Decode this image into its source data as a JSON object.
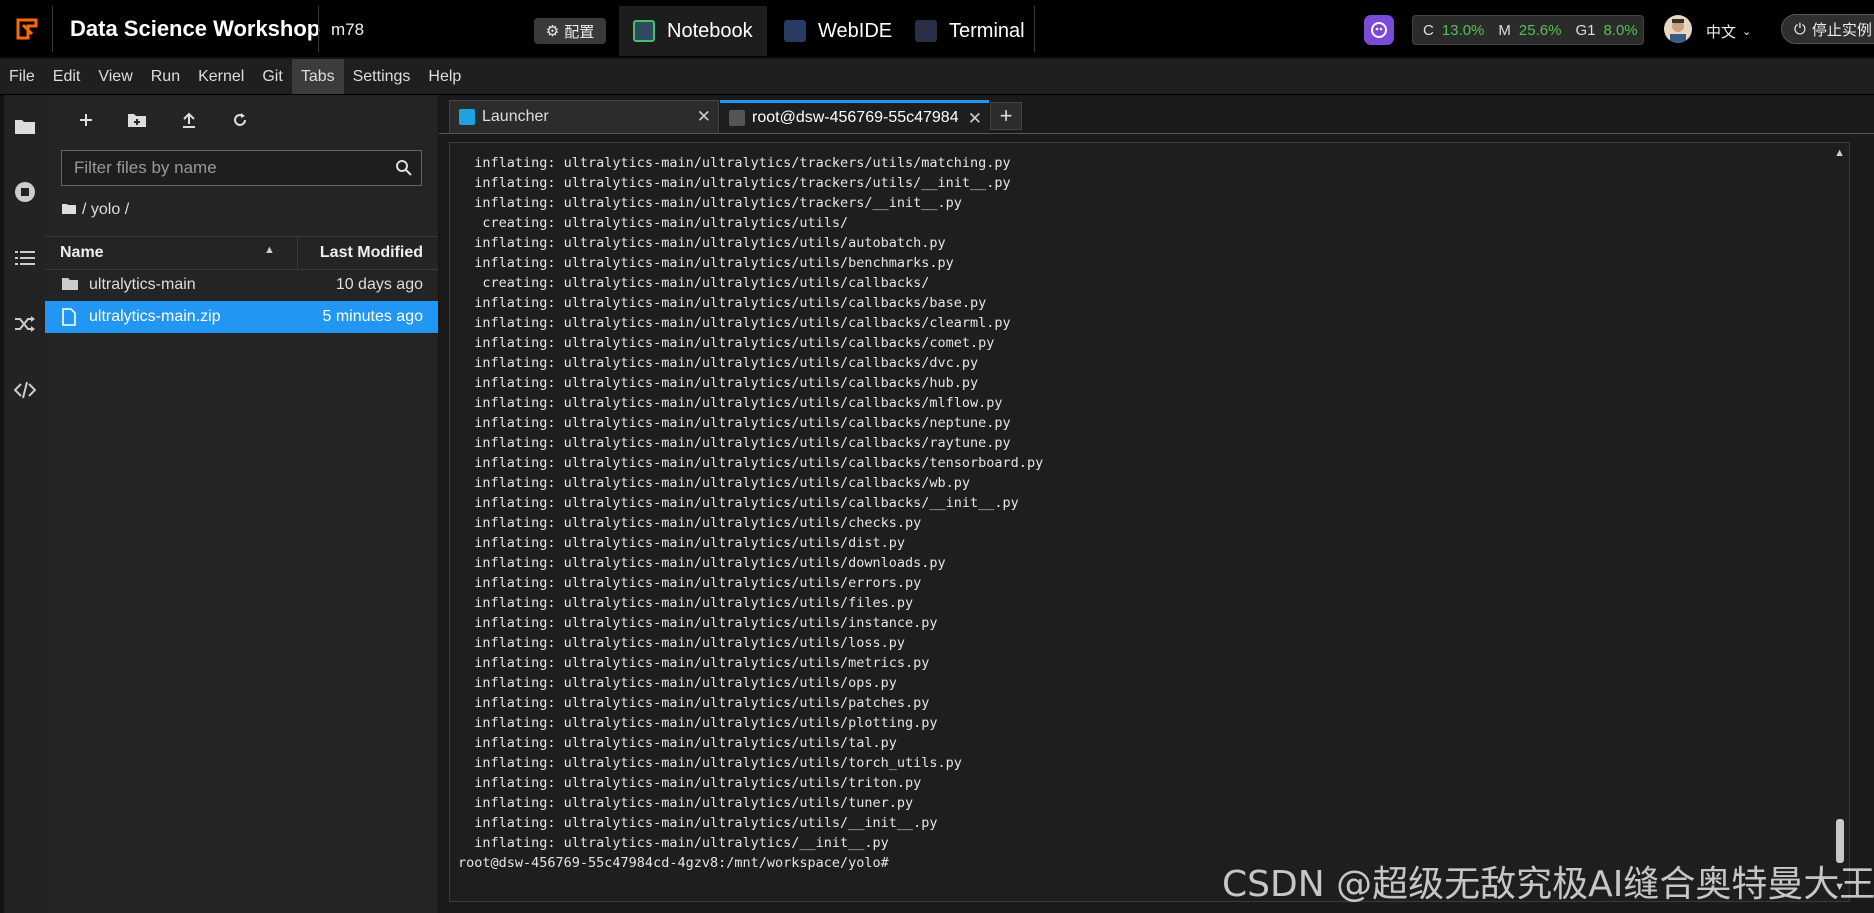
{
  "topbar": {
    "app_title": "Data Science Workshop",
    "instance_name": "m78",
    "config_label": "配置",
    "modes": [
      {
        "label": "Notebook",
        "active": true
      },
      {
        "label": "WebIDE",
        "active": false
      },
      {
        "label": "Terminal",
        "active": false
      }
    ],
    "resources": {
      "cpu_label": "C",
      "cpu_value": "13.0%",
      "mem_label": "M",
      "mem_value": "25.6%",
      "gpu_label": "G1",
      "gpu_value": "8.0%"
    },
    "language": "中文",
    "stop_label": "停止实例"
  },
  "menubar": {
    "items": [
      "File",
      "Edit",
      "View",
      "Run",
      "Kernel",
      "Git",
      "Tabs",
      "Settings",
      "Help"
    ],
    "active": "Tabs"
  },
  "filebrowser": {
    "filter_placeholder": "Filter files by name",
    "breadcrumb": "/ yolo /",
    "col_name": "Name",
    "col_modified": "Last Modified",
    "files": [
      {
        "name": "ultralytics-main",
        "type": "folder",
        "modified": "10 days ago",
        "selected": false
      },
      {
        "name": "ultralytics-main.zip",
        "type": "file",
        "modified": "5 minutes ago",
        "selected": true
      }
    ]
  },
  "tabs": {
    "launcher_label": "Launcher",
    "terminal_label": "root@dsw-456769-55c47984",
    "add_label": "+"
  },
  "terminal": {
    "lines": [
      "  inflating: ultralytics-main/ultralytics/trackers/utils/matching.py",
      "  inflating: ultralytics-main/ultralytics/trackers/utils/__init__.py",
      "  inflating: ultralytics-main/ultralytics/trackers/__init__.py",
      "   creating: ultralytics-main/ultralytics/utils/",
      "  inflating: ultralytics-main/ultralytics/utils/autobatch.py",
      "  inflating: ultralytics-main/ultralytics/utils/benchmarks.py",
      "   creating: ultralytics-main/ultralytics/utils/callbacks/",
      "  inflating: ultralytics-main/ultralytics/utils/callbacks/base.py",
      "  inflating: ultralytics-main/ultralytics/utils/callbacks/clearml.py",
      "  inflating: ultralytics-main/ultralytics/utils/callbacks/comet.py",
      "  inflating: ultralytics-main/ultralytics/utils/callbacks/dvc.py",
      "  inflating: ultralytics-main/ultralytics/utils/callbacks/hub.py",
      "  inflating: ultralytics-main/ultralytics/utils/callbacks/mlflow.py",
      "  inflating: ultralytics-main/ultralytics/utils/callbacks/neptune.py",
      "  inflating: ultralytics-main/ultralytics/utils/callbacks/raytune.py",
      "  inflating: ultralytics-main/ultralytics/utils/callbacks/tensorboard.py",
      "  inflating: ultralytics-main/ultralytics/utils/callbacks/wb.py",
      "  inflating: ultralytics-main/ultralytics/utils/callbacks/__init__.py",
      "  inflating: ultralytics-main/ultralytics/utils/checks.py",
      "  inflating: ultralytics-main/ultralytics/utils/dist.py",
      "  inflating: ultralytics-main/ultralytics/utils/downloads.py",
      "  inflating: ultralytics-main/ultralytics/utils/errors.py",
      "  inflating: ultralytics-main/ultralytics/utils/files.py",
      "  inflating: ultralytics-main/ultralytics/utils/instance.py",
      "  inflating: ultralytics-main/ultralytics/utils/loss.py",
      "  inflating: ultralytics-main/ultralytics/utils/metrics.py",
      "  inflating: ultralytics-main/ultralytics/utils/ops.py",
      "  inflating: ultralytics-main/ultralytics/utils/patches.py",
      "  inflating: ultralytics-main/ultralytics/utils/plotting.py",
      "  inflating: ultralytics-main/ultralytics/utils/tal.py",
      "  inflating: ultralytics-main/ultralytics/utils/torch_utils.py",
      "  inflating: ultralytics-main/ultralytics/utils/triton.py",
      "  inflating: ultralytics-main/ultralytics/utils/tuner.py",
      "  inflating: ultralytics-main/ultralytics/utils/__init__.py",
      "  inflating: ultralytics-main/ultralytics/__init__.py",
      "root@dsw-456769-55c47984cd-4gzv8:/mnt/workspace/yolo#"
    ]
  },
  "watermark": "CSDN @超级无敌究极AI缝合奥特曼大王",
  "colors": {
    "accent": "#2196f3",
    "good": "#4fc34f",
    "brand_logo": "#ff6a00",
    "copilot": "#7a4bd6"
  }
}
